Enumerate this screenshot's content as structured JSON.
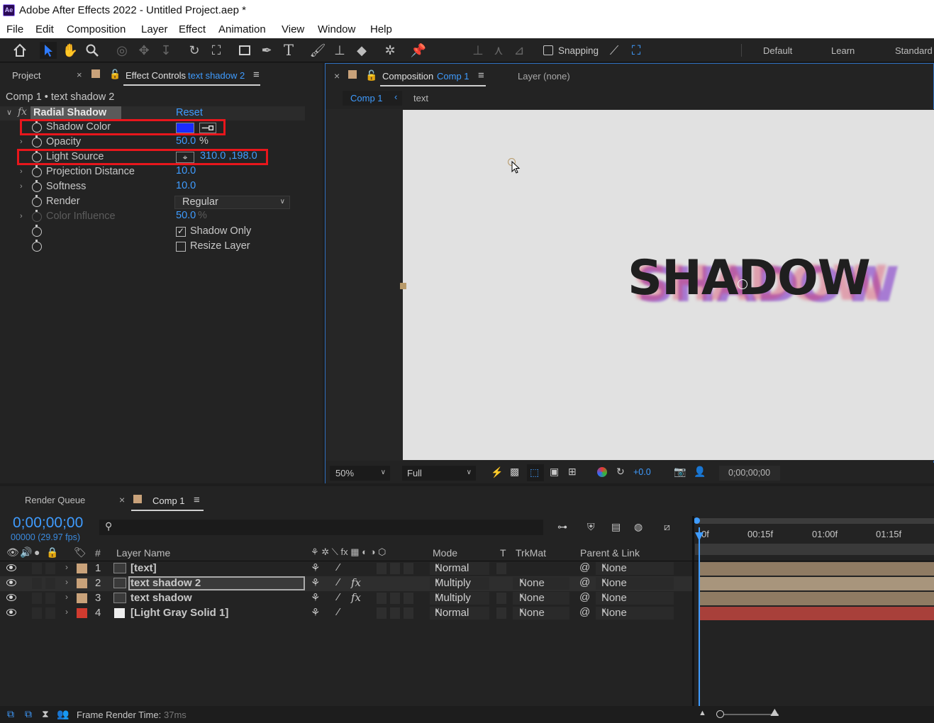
{
  "app": {
    "window_title": "Adobe After Effects 2022 - Untitled Project.aep *",
    "logo": "Ae"
  },
  "menu": [
    "File",
    "Edit",
    "Composition",
    "Layer",
    "Effect",
    "Animation",
    "View",
    "Window",
    "Help"
  ],
  "toolbar": {
    "snapping_label": "Snapping",
    "workspaces": [
      "Default",
      "Learn",
      "Standard"
    ]
  },
  "left_panel": {
    "tab_project": "Project",
    "tab_effect_controls": "Effect Controls",
    "tab_effect_controls_layer": "text shadow 2",
    "breadcrumb": "Comp 1 • text shadow 2",
    "effect": {
      "name": "Radial Shadow",
      "reset_label": "Reset",
      "fx_label": "fx",
      "shadow_color_hex": "#1a2bff",
      "properties": [
        {
          "name": "Shadow Color",
          "value": ""
        },
        {
          "name": "Opacity",
          "value": "50.0",
          "unit": "%"
        },
        {
          "name": "Light Source",
          "value": "310.0 ,198.0"
        },
        {
          "name": "Projection Distance",
          "value": "10.0"
        },
        {
          "name": "Softness",
          "value": "10.0"
        },
        {
          "name": "Render",
          "value": "Regular"
        },
        {
          "name": "Color Influence",
          "value": "50.0",
          "unit": "%"
        }
      ],
      "checkboxes": [
        {
          "label": "Shadow Only",
          "checked": true
        },
        {
          "label": "Resize Layer",
          "checked": false
        }
      ]
    }
  },
  "comp_panel": {
    "tab_label": "Composition",
    "tab_comp": "Comp 1",
    "layer_tab": "Layer (none)",
    "breadcrumb_comp": "Comp 1",
    "breadcrumb_layer": "text",
    "canvas_text": "SHADOW",
    "zoom": "50%",
    "resolution": "Full",
    "exposure": "+0.0",
    "timecode": "0;00;00;00"
  },
  "timeline": {
    "tab_render_queue": "Render Queue",
    "tab_comp": "Comp 1",
    "current_time": "0;00;00;00",
    "frame_info": "00000 (29.97 fps)",
    "ruler_labels": [
      "0f",
      "00:15f",
      "01:00f",
      "01:15f"
    ],
    "column_headers": {
      "number": "#",
      "layer_name": "Layer Name",
      "mode": "Mode",
      "t": "T",
      "trkmat": "TrkMat",
      "parent": "Parent & Link"
    },
    "layers": [
      {
        "num": "1",
        "name": "[text]",
        "mode": "Normal",
        "trkmat": "",
        "parent": "None",
        "label_color": "#c9a27a",
        "bar_color": "#8f7b63",
        "fx": false
      },
      {
        "num": "2",
        "name": "text shadow 2",
        "mode": "Multiply",
        "trkmat": "None",
        "parent": "None",
        "label_color": "#c9a27a",
        "bar_color": "#a8957c",
        "fx": true
      },
      {
        "num": "3",
        "name": "text shadow",
        "mode": "Multiply",
        "trkmat": "None",
        "parent": "None",
        "label_color": "#c9a27a",
        "bar_color": "#8f7b63",
        "fx": true
      },
      {
        "num": "4",
        "name": "[Light Gray Solid 1]",
        "mode": "Normal",
        "trkmat": "None",
        "parent": "None",
        "label_color": "#d13b2f",
        "bar_color": "#a8403a",
        "fx": false
      }
    ],
    "status_label": "Frame Render Time:",
    "status_value": "37ms"
  }
}
